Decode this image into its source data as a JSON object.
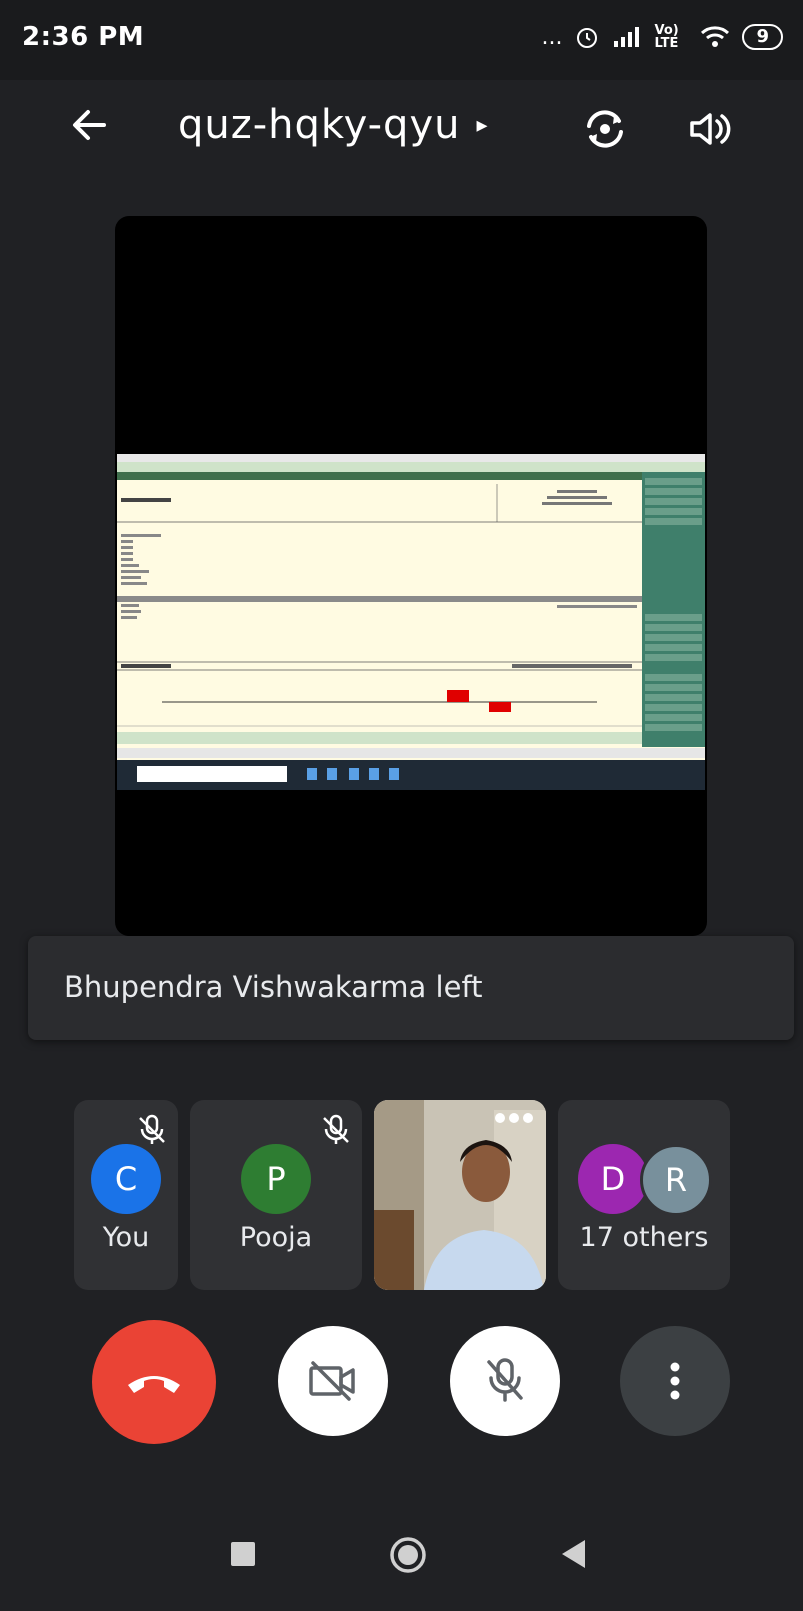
{
  "status_bar": {
    "time": "2:36 PM",
    "dots": "...",
    "network": "Vo) LTE",
    "battery": "9"
  },
  "header": {
    "meeting_code": "quz-hqky-qyu",
    "caret": "▸"
  },
  "toast": {
    "message": "Bhupendra Vishwakarma left"
  },
  "participants": [
    {
      "initial": "C",
      "name": "You",
      "avatar_color": "#1a73e8",
      "muted": true
    },
    {
      "initial": "P",
      "name": "Pooja",
      "avatar_color": "#2e7d32",
      "muted": true
    },
    {
      "initial": "",
      "name": "",
      "type": "video"
    },
    {
      "initials": [
        "D",
        "R"
      ],
      "name": "17 others",
      "avatar_colors": [
        "#9c27b0",
        "#78909c"
      ]
    }
  ],
  "colors": {
    "background": "#202124",
    "tile": "#303134",
    "end_call": "#ea4335",
    "control_light": "#ffffff",
    "control_dark": "#3c4043"
  },
  "icons": {
    "back": "arrow-left-icon",
    "switch_camera": "camera-switch-icon",
    "speaker": "speaker-icon",
    "end_call": "phone-hangup-icon",
    "camera_off": "video-off-icon",
    "mic_off": "mic-off-icon",
    "more": "more-vertical-icon"
  }
}
